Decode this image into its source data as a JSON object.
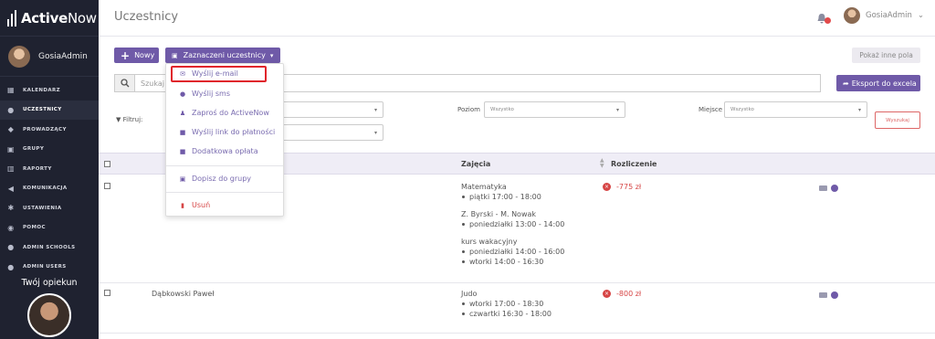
{
  "app": {
    "brand_bold": "Active",
    "brand_thin": "Now"
  },
  "sidebar": {
    "user_name": "GosiaAdmin",
    "items": [
      {
        "label": "KALENDARZ",
        "icon": "calendar-icon"
      },
      {
        "label": "UCZESTNICY",
        "icon": "user-icon"
      },
      {
        "label": "PROWADZĄCY",
        "icon": "graduation-cap-icon"
      },
      {
        "label": "GRUPY",
        "icon": "users-icon"
      },
      {
        "label": "RAPORTY",
        "icon": "chart-icon"
      },
      {
        "label": "KOMUNIKACJA",
        "icon": "megaphone-icon"
      },
      {
        "label": "USTAWIENIA",
        "icon": "gear-icon"
      },
      {
        "label": "POMOC",
        "icon": "help-icon"
      },
      {
        "label": "ADMIN SCHOOLS",
        "icon": "user-icon"
      },
      {
        "label": "ADMIN USERS",
        "icon": "user-icon"
      }
    ],
    "active_index": 1,
    "guardian_title": "Twój opiekun"
  },
  "header": {
    "title": "Uczestnicy",
    "user_name": "GosiaAdmin",
    "user_caret": "⌄"
  },
  "toolbar": {
    "new_label": "Nowy",
    "selected_label": "Zaznaczeni uczestnicy",
    "more_fields_label": "Pokaż inne pola",
    "search_placeholder": "Szukaj",
    "export_label": "Eksport do excela"
  },
  "filters": {
    "label": "Filtruj:",
    "level_label": "Poziom",
    "level_value": "Wszystko",
    "place_label": "Miejsce",
    "place_value": "Wszystko",
    "search_button": "Wyszukaj"
  },
  "dropdown": {
    "items": [
      {
        "label": "Wyślij e-mail",
        "icon": "mail-icon"
      },
      {
        "label": "Wyślij sms",
        "icon": "chat-icon"
      },
      {
        "label": "Zaproś do ActiveNow",
        "icon": "user-plus-icon"
      },
      {
        "label": "Wyślij link do płatności",
        "icon": "wallet-icon"
      },
      {
        "label": "Dodatkowa opłata",
        "icon": "wallet-icon"
      },
      {
        "label": "Dopisz do grupy",
        "icon": "users-icon"
      },
      {
        "label": "Usuń",
        "icon": "trash-icon"
      }
    ]
  },
  "table": {
    "columns": {
      "classes": "Zajęcia",
      "settlement": "Rozliczenie"
    },
    "rows": [
      {
        "name": "",
        "courses": [
          {
            "title": "Matematyka",
            "slots": [
              "piątki 17:00 - 18:00"
            ]
          },
          {
            "title": "Z. Byrski - M. Nowak",
            "slots": [
              "poniedziałki 13:00 - 14:00"
            ]
          },
          {
            "title": "kurs wakacyjny",
            "slots": [
              "poniedziałki 14:00 - 16:00",
              "wtorki 14:00 - 16:30"
            ]
          }
        ],
        "settlement": "-775 zł"
      },
      {
        "name": "Dąbkowski Paweł",
        "courses": [
          {
            "title": "Judo",
            "slots": [
              "wtorki 17:00 - 18:30",
              "czwartki 16:30 - 18:00"
            ]
          }
        ],
        "settlement": "-800 zł"
      }
    ]
  },
  "colors": {
    "accent": "#6f5aa8",
    "sidebar": "#1f2230",
    "negative": "#d64545",
    "highlight": "#e0242b"
  }
}
